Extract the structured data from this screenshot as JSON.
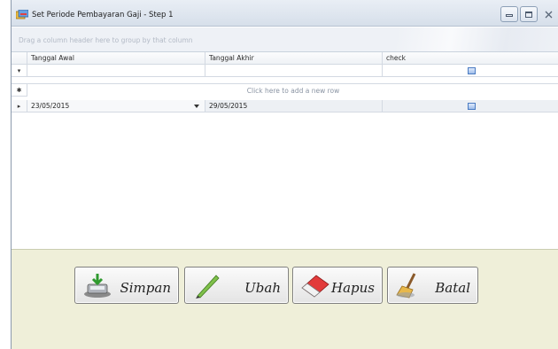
{
  "window": {
    "title": "Set Periode Pembayaran Gaji - Step 1",
    "icons": {
      "app": "app-form-icon",
      "minimize": "minimize-icon",
      "maximize": "maximize-icon",
      "close": "close-icon"
    }
  },
  "group_panel": {
    "hint": "Drag a column header here to group by that column"
  },
  "grid": {
    "columns": [
      "Tanggal Awal",
      "Tanggal Akhir",
      "check"
    ],
    "new_row_hint": "Click here to add a new row",
    "indicators": {
      "filter": "▾",
      "new_row": "✱",
      "current": "▸"
    },
    "rows": [
      {
        "tanggal_awal": "23/05/2015",
        "tanggal_akhir": "29/05/2015",
        "check": false
      }
    ]
  },
  "buttons": {
    "simpan": "Simpan",
    "ubah": "Ubah",
    "hapus": "Hapus",
    "batal": "Batal"
  },
  "colors": {
    "titlebar": "#dfe6ef",
    "bottom_panel": "#efefd9",
    "checkbox": "#4a7bc2"
  }
}
